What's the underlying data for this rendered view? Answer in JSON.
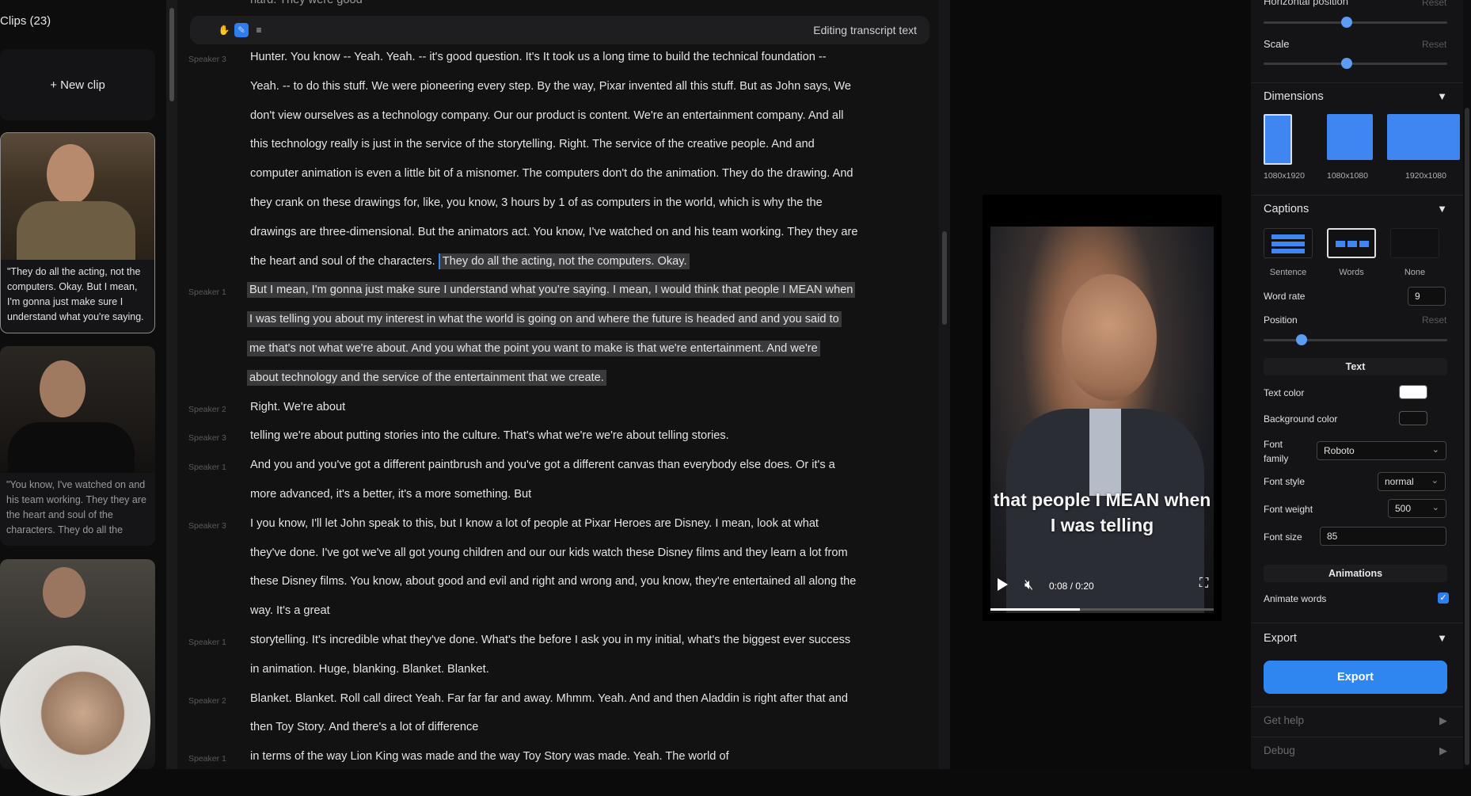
{
  "clips": {
    "title": "Clips (23)",
    "new_clip": "+ New clip",
    "items": [
      {
        "text": "\"They do all the acting, not the computers. Okay. But I mean, I'm gonna just make sure I understand what you're saying. I mean, I"
      },
      {
        "text": "\"You know, I've watched on and his team working. They they are the heart and soul of the characters. They do all the acting, not the"
      }
    ]
  },
  "transcript": {
    "toolbar": {
      "editing_label": "Editing transcript text"
    },
    "partial_top": "hard. They were good",
    "lines": [
      {
        "speaker": "Speaker 3",
        "text": "Hunter. You know -- Yeah. Yeah. -- it's good question. It's It took us a long time to build the technical foundation --"
      },
      {
        "speaker": "",
        "text": "Yeah. -- to do this stuff. We were pioneering every step. By the way, Pixar invented all this stuff. But as John says, We"
      },
      {
        "speaker": "",
        "text": "don't view ourselves as a technology company. Our our product is content. We're an entertainment company. And all"
      },
      {
        "speaker": "",
        "text": "this technology really is just in the service of the storytelling. Right. The service of the creative people. And and"
      },
      {
        "speaker": "",
        "text": "computer animation is even a little bit of a misnomer. The computers don't do the animation. They do the drawing. And"
      },
      {
        "speaker": "",
        "text": "they crank on these drawings for, like, you know, 3 hours by 1 of as computers in the world, which is why the the"
      },
      {
        "speaker": "",
        "text": "drawings are three-dimensional. But the animators act. You know, I've watched on and his team working. They they are"
      },
      {
        "speaker": "",
        "text": "the heart and soul of the characters.",
        "hl": "They do all the acting, not the computers. Okay."
      },
      {
        "speaker": "Speaker 1",
        "hl_full": "But I mean, I'm gonna just make sure I understand what you're saying. I mean, I would think that people I MEAN when"
      },
      {
        "speaker": "",
        "hl_full": "I was telling you about my interest in what the world is going on and where the future is headed and and you said to"
      },
      {
        "speaker": "",
        "hl_full": "me that's not what we're about. And you what the point you want to make is that we're entertainment. And we're"
      },
      {
        "speaker": "",
        "hl_full": "about technology and the service of the entertainment that we create."
      },
      {
        "speaker": "Speaker 2",
        "text": "Right. We're about"
      },
      {
        "speaker": "Speaker 3",
        "text": "telling we're about putting stories into the culture. That's what we're we're about telling stories."
      },
      {
        "speaker": "Speaker 1",
        "text": "And you and you've got a different paintbrush and you've got a different canvas than everybody else does. Or it's a"
      },
      {
        "speaker": "",
        "text": "more advanced, it's a better, it's a more something. But"
      },
      {
        "speaker": "Speaker 3",
        "text": "I you know, I'll let John speak to this, but I know a lot of people at Pixar Heroes are Disney. I mean, look at what"
      },
      {
        "speaker": "",
        "text": "they've done. I've got we've all got young children and our our kids watch these Disney films and they learn a lot from"
      },
      {
        "speaker": "",
        "text": "these Disney films. You know, about good and evil and right and wrong and, you know, they're entertained all along the"
      },
      {
        "speaker": "",
        "text": "way. It's a great"
      },
      {
        "speaker": "Speaker 1",
        "text": "storytelling. It's incredible what they've done. What's the before I ask you in my initial, what's the biggest ever success"
      },
      {
        "speaker": "",
        "text": "in animation. Huge, blanking. Blanket. Blanket."
      },
      {
        "speaker": "Speaker 2",
        "text": "Blanket. Blanket. Roll call direct Yeah. Far far far and away. Mhmm. Yeah. And and then Aladdin is right after that and"
      },
      {
        "speaker": "",
        "text": "then Toy Story. And there's a lot of difference"
      },
      {
        "speaker": "Speaker 1",
        "text": "in terms of the way Lion King was made and the way Toy Story was made. Yeah. The world of"
      }
    ]
  },
  "preview": {
    "caption_line1": "that people I MEAN when",
    "caption_line2": "I was telling",
    "time": "0:08 / 0:20",
    "progress": 0.4
  },
  "settings": {
    "horizontal_position": "Horizontal position",
    "reset": "Reset",
    "scale": "Scale",
    "dimensions": {
      "title": "Dimensions",
      "options": [
        "1080x1920",
        "1080x1080",
        "1920x1080"
      ]
    },
    "captions": {
      "title": "Captions",
      "options": [
        "Sentence",
        "Words",
        "None"
      ],
      "selected": "Words"
    },
    "word_rate_label": "Word rate",
    "word_rate": "9",
    "position_label": "Position",
    "text_section": "Text",
    "text_color_label": "Text color",
    "text_color": "#ffffff",
    "bg_color_label": "Background color",
    "font_family_label": "Font family",
    "font_family": "Roboto",
    "font_style_label": "Font style",
    "font_style": "normal",
    "font_weight_label": "Font weight",
    "font_weight": "500",
    "font_size_label": "Font size",
    "font_size": "85",
    "animations_section": "Animations",
    "animate_words_label": "Animate words",
    "animate_words": true,
    "export_title": "Export",
    "export_button": "Export",
    "get_help": "Get help",
    "debug": "Debug"
  },
  "colors": {
    "accent": "#2f86f0",
    "highlight": "#3a3a3c"
  }
}
